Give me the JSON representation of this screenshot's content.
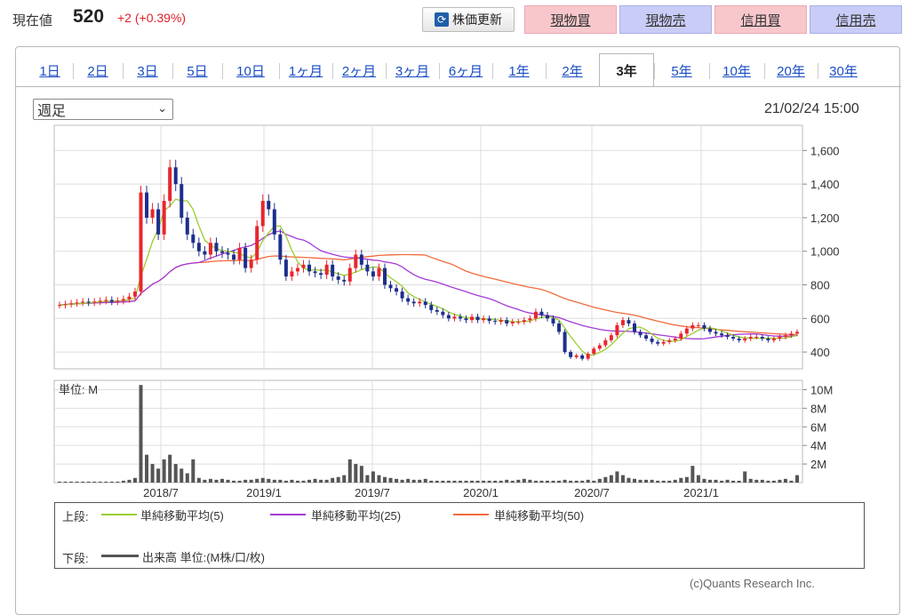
{
  "header": {
    "price_label": "現在値",
    "price_value": "520",
    "price_change": "+2 (+0.39%)",
    "refresh_label": "株価更新",
    "buttons": [
      "現物買",
      "現物売",
      "信用買",
      "信用売"
    ]
  },
  "tabs": [
    "1日",
    "2日",
    "3日",
    "5日",
    "10日",
    "1ヶ月",
    "2ヶ月",
    "3ヶ月",
    "6ヶ月",
    "1年",
    "2年",
    "3年",
    "5年",
    "10年",
    "20年",
    "30年"
  ],
  "active_tab": "3年",
  "period_select": "週足",
  "timestamp": "21/02/24 15:00",
  "credit": "(c)Quants Research Inc.",
  "legend": {
    "upper_label": "上段:",
    "lower_label": "下段:",
    "ma5": "単純移動平均(5)",
    "ma25": "単純移動平均(25)",
    "ma50": "単純移動平均(50)",
    "volume": "出来高 単位:(M株/口/枚)"
  },
  "colors": {
    "up": "#e8262c",
    "down": "#1c2f8c",
    "ma5": "#9acd32",
    "ma25": "#a43ad6",
    "ma50": "#f26a3b",
    "volume": "#555555"
  },
  "chart_data": [
    {
      "type": "candlestick",
      "title": "",
      "x_ticks": [
        "2018/7",
        "2019/1",
        "2019/7",
        "2020/1",
        "2020/7",
        "2021/1"
      ],
      "y_ticks": [
        "1,600",
        "1,400",
        "1,200",
        "1,000",
        "800",
        "600",
        "400"
      ],
      "ylim": [
        300,
        1750
      ],
      "closes": [
        680,
        685,
        690,
        695,
        700,
        695,
        700,
        705,
        710,
        700,
        705,
        715,
        730,
        760,
        1350,
        1200,
        1250,
        1100,
        1300,
        1500,
        1400,
        1200,
        1100,
        1050,
        1000,
        980,
        1050,
        1000,
        990,
        980,
        950,
        1020,
        900,
        950,
        1150,
        1300,
        1250,
        1100,
        950,
        850,
        880,
        900,
        920,
        880,
        870,
        860,
        920,
        850,
        830,
        820,
        900,
        980,
        920,
        880,
        850,
        900,
        800,
        780,
        760,
        720,
        700,
        690,
        700,
        680,
        650,
        640,
        620,
        600,
        610,
        600,
        590,
        610,
        590,
        600,
        585,
        580,
        590,
        570,
        580,
        580,
        590,
        600,
        640,
        620,
        600,
        570,
        520,
        400,
        370,
        380,
        360,
        390,
        420,
        440,
        470,
        500,
        560,
        590,
        570,
        520,
        500,
        480,
        460,
        450,
        460,
        470,
        480,
        510,
        540,
        560,
        560,
        540,
        520,
        510,
        500,
        490,
        480,
        470,
        480,
        490,
        490,
        480,
        470,
        480,
        490,
        500,
        510,
        520
      ],
      "volume": {
        "unit": "M",
        "y_ticks": [
          "10M",
          "8M",
          "6M",
          "4M",
          "2M"
        ],
        "ylim": [
          0,
          11
        ],
        "values": [
          0.1,
          0.1,
          0.1,
          0.1,
          0.1,
          0.1,
          0.1,
          0.1,
          0.1,
          0.1,
          0.1,
          0.2,
          0.3,
          0.5,
          10.5,
          3.0,
          2.0,
          1.5,
          2.5,
          3.0,
          2.0,
          1.5,
          1.0,
          2.5,
          0.5,
          0.3,
          0.4,
          0.3,
          0.4,
          0.3,
          0.2,
          0.2,
          0.3,
          0.3,
          0.4,
          0.5,
          0.4,
          0.3,
          0.3,
          0.2,
          0.3,
          0.2,
          0.2,
          0.3,
          0.4,
          0.3,
          0.3,
          0.5,
          0.6,
          0.8,
          2.5,
          2.0,
          1.8,
          0.8,
          1.2,
          0.8,
          0.6,
          0.5,
          0.4,
          0.3,
          0.4,
          0.3,
          0.3,
          0.4,
          0.2,
          0.2,
          0.2,
          0.2,
          0.2,
          0.2,
          0.2,
          0.2,
          0.2,
          0.2,
          0.2,
          0.2,
          0.2,
          0.3,
          0.2,
          0.3,
          0.4,
          0.3,
          0.2,
          0.2,
          0.2,
          0.2,
          0.2,
          0.3,
          0.2,
          0.2,
          0.2,
          0.3,
          0.2,
          0.4,
          0.6,
          0.8,
          1.2,
          0.8,
          0.5,
          0.4,
          0.3,
          0.3,
          0.3,
          0.2,
          0.2,
          0.2,
          0.3,
          0.5,
          0.6,
          1.8,
          0.8,
          0.4,
          0.3,
          0.3,
          0.2,
          0.3,
          0.2,
          0.2,
          1.2,
          0.4,
          0.3,
          0.3,
          0.2,
          0.2,
          0.3,
          0.4,
          0.2,
          0.8
        ]
      }
    }
  ]
}
